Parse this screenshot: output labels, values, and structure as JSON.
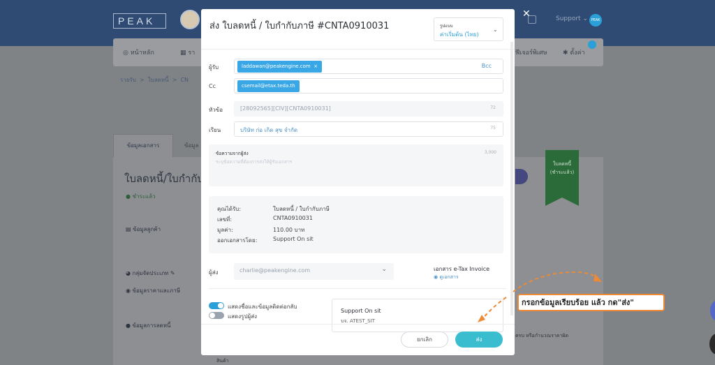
{
  "app": {
    "logo_text": "PEAK",
    "support_label": "Support",
    "support_caret": "⌄",
    "badge_text": "PEAK"
  },
  "nav": {
    "home": "หน้าหลัก",
    "report": "รา",
    "special": "ฟีเจอร์พิเศษ",
    "settings": "ตั้งค่า"
  },
  "breadcrumb": {
    "item1": "รายรับ",
    "item2": "ใบลดหนี้",
    "item3": "CN",
    "sep": ">"
  },
  "background": {
    "tab_doc": "ข้อมูลเอกสาร",
    "tab_other": "ข้อมูล",
    "title": "ใบลดหนี้/ใบกำกับภาษี",
    "status": "ชำระแล้ว",
    "sec_customer": "ข้อมูลลูกค้า",
    "sec_group": "กลุ่มจัดประเภท",
    "sec_price": "ข้อมูลราคาและภาษี",
    "sec_reduce": "ข้อมูลการลดหนี้",
    "ribbon_line1": "ใบลดหนี้",
    "ribbon_line2": "(ชำระแล้ว)",
    "right_text": "ครบ หรือกำนวณราคาผิด",
    "bottom_text": "สินค้า"
  },
  "modal": {
    "title": "ส่ง ใบลดหนี้ / ใบกำกับภาษี #CNTA0910031",
    "format_label": "รูปแบบ",
    "format_value": "ค่าเริ่มต้น (ไทย)",
    "to_label": "ผู้รับ",
    "to_chip": "laddawan@peakengine.com",
    "chip_remove": "×",
    "bcc": "Bcc",
    "cc_label": "Cc",
    "cc_chip": "csemail@etax.teda.th",
    "subject_label": "หัวข้อ",
    "subject_value": "[28092565][CIV][CNTA0910031]",
    "subject_count": "72",
    "dear_label": "เรียน",
    "dear_value": "บริษัท ก่อ เกิด สุข จำกัด",
    "dear_count": "75",
    "message_label": "ข้อความจากผู้ส่ง",
    "message_placeholder": "ระบุข้อความที่ต้องการส่งให้ผู้รับเอกสาร",
    "message_count": "3,000",
    "summary": {
      "k1": "คุณได้รับ:",
      "v1": "ใบลดหนี้ / ใบกำกับภาษี",
      "k2": "เลขที่:",
      "v2": "CNTA0910031",
      "k3": "มูลค่า:",
      "v3": "110.00 บาท",
      "k4": "ออกเอกสารโดย:",
      "v4": "Support On sit"
    },
    "sender_label": "ผู้ส่ง",
    "sender_value": "charlie@peakengine.com",
    "etax_title": "เอกสาร e-Tax Invoice",
    "etax_link": "ดูเอกสาร",
    "toggle1_label": "แสดงชื่อและข้อมูลติดต่อกลับ",
    "toggle2_label": "แสดงรูปผู้ส่ง",
    "card_title": "Support On sit",
    "card_sub": "บจ. ATEST_SIT",
    "cancel": "ยกเลิก",
    "send": "ส่ง",
    "close": "✕"
  },
  "annotation": {
    "callout": "กรอกข้อมูลเรียบร้อย แล้ว กด\"ส่ง\""
  },
  "colors": {
    "accent": "#39a7e6",
    "send_button": "#3bbdd0",
    "callout_border": "#ee8a35",
    "ribbon": "#2b6b39"
  }
}
